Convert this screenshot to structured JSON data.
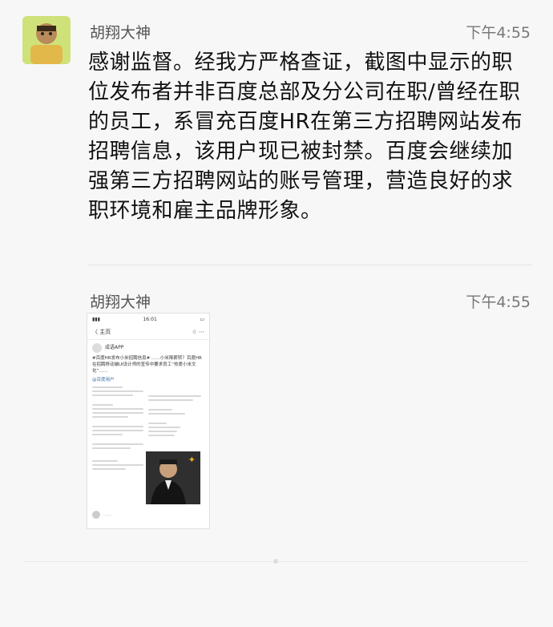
{
  "messages": [
    {
      "sender": "胡翔大神",
      "time": "下午4:55",
      "text": "感谢监督。经我方严格查证，截图中显示的职位发布者并非百度总部及分公司在职/曾经在职的员工，系冒充百度HR在第三方招聘网站发布招聘信息，该用户现已被封禁。百度会继续加强第三方招聘网站的账号管理，营造良好的求职环境和雇主品牌形象。"
    },
    {
      "sender": "胡翔大神",
      "time": "下午4:55",
      "image": {
        "status_time": "16:01",
        "back_label": "〈 主页",
        "account_name": "成语APP",
        "post_text": "#百度HR发布小米招聘信息# ……小米降薪转？百度HR在招聘移动端UI设计师的宣传中要求员工“热爱小米文化”……",
        "link_text": "@百度用户"
      }
    }
  ]
}
